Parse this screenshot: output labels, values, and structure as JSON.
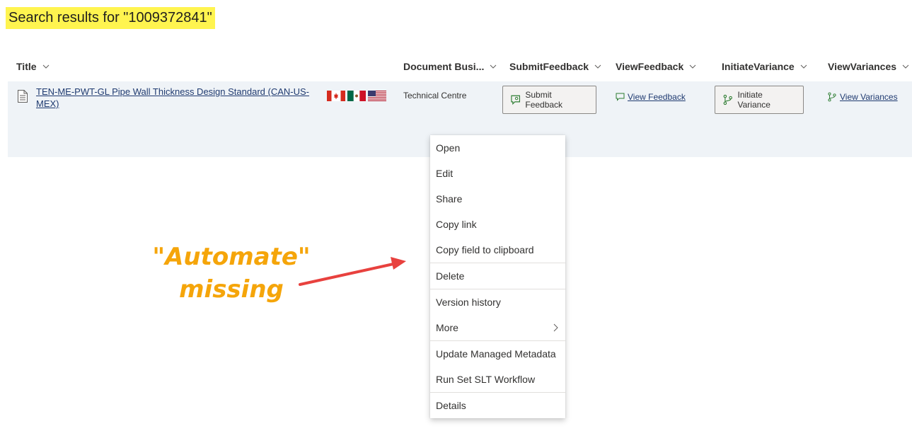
{
  "search": {
    "title": "Search results for \"1009372841\""
  },
  "columns": [
    {
      "label": "Title"
    },
    {
      "label": "Document Busi..."
    },
    {
      "label": "SubmitFeedback"
    },
    {
      "label": "ViewFeedback"
    },
    {
      "label": "InitiateVariance"
    },
    {
      "label": "ViewVariances"
    }
  ],
  "row": {
    "title": "TEN-ME-PWT-GL Pipe Wall Thickness Design Standard (CAN-US-MEX)",
    "flags": [
      "canada-flag-icon",
      "mexico-flag-icon",
      "usa-flag-icon"
    ],
    "business": "Technical Centre",
    "submit_feedback": "Submit Feedback",
    "view_feedback": "View Feedback",
    "initiate_variance": "Initiate Variance",
    "view_variances": "View Variances"
  },
  "menu": {
    "items": [
      "Open",
      "Edit",
      "Share",
      "Copy link",
      "Copy field to clipboard",
      "Delete",
      "Version history",
      "More",
      "Update Managed Metadata",
      "Run Set SLT Workflow",
      "Details"
    ]
  },
  "annotation": {
    "line1": "\"Automate\"",
    "line2": "missing",
    "color": "#f5a50a",
    "arrow_color": "#e8413e"
  }
}
